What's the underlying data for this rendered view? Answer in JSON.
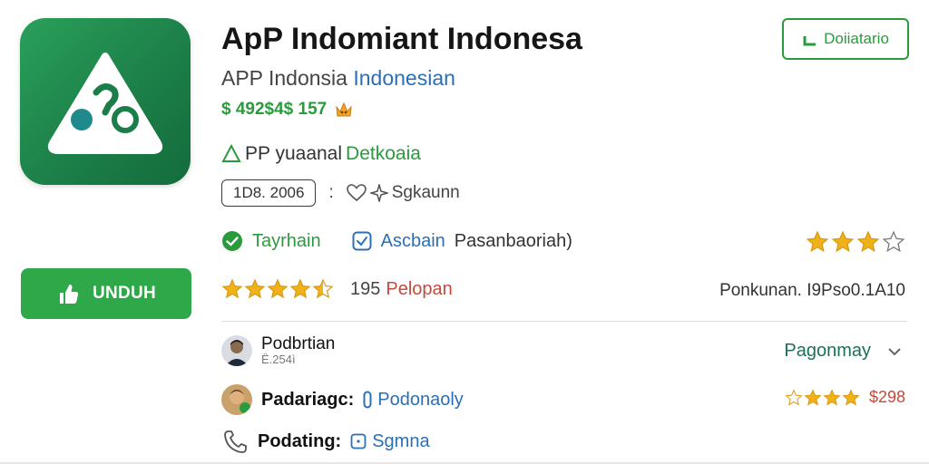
{
  "app": {
    "title": "ApP Indomiant Indonesa",
    "subtitle_prefix": "APP Indonsia",
    "subtitle_suffix": "Indonesian",
    "price": "$ 492$4$ 157",
    "dev_prefix": "PP yuaanal",
    "dev_name": "Detkoaia",
    "version": "1D8. 2006",
    "separator": ":",
    "wishlist_label": "Sgkaunn",
    "install_label": "Doiiatario",
    "download_label": "UNDUH"
  },
  "features": {
    "item1": "Tayrhain",
    "item2": "Ascbain",
    "item2_suffix": "Pasanbaoriah)"
  },
  "rating": {
    "stars": 4.5,
    "reviews_count": "195",
    "reviews_label": "Pelopan",
    "right_stars": 3,
    "right_meta": "Ponkunan. I9Pso0.1A10"
  },
  "list": {
    "row1": {
      "name": "Podbrtian",
      "sub": "Ё.254ì",
      "link": "Pagonmay"
    },
    "row2": {
      "name": "Padariagc:",
      "value": "Podonaoly",
      "price": "$298",
      "stars": 3
    },
    "row3": {
      "name": "Podating:",
      "value": "Sgmna"
    }
  },
  "colors": {
    "brand_green": "#2a9b3d",
    "icon_green": "#1b7d47",
    "link_blue": "#2b6fb5",
    "star_gold": "#f0b21a"
  }
}
